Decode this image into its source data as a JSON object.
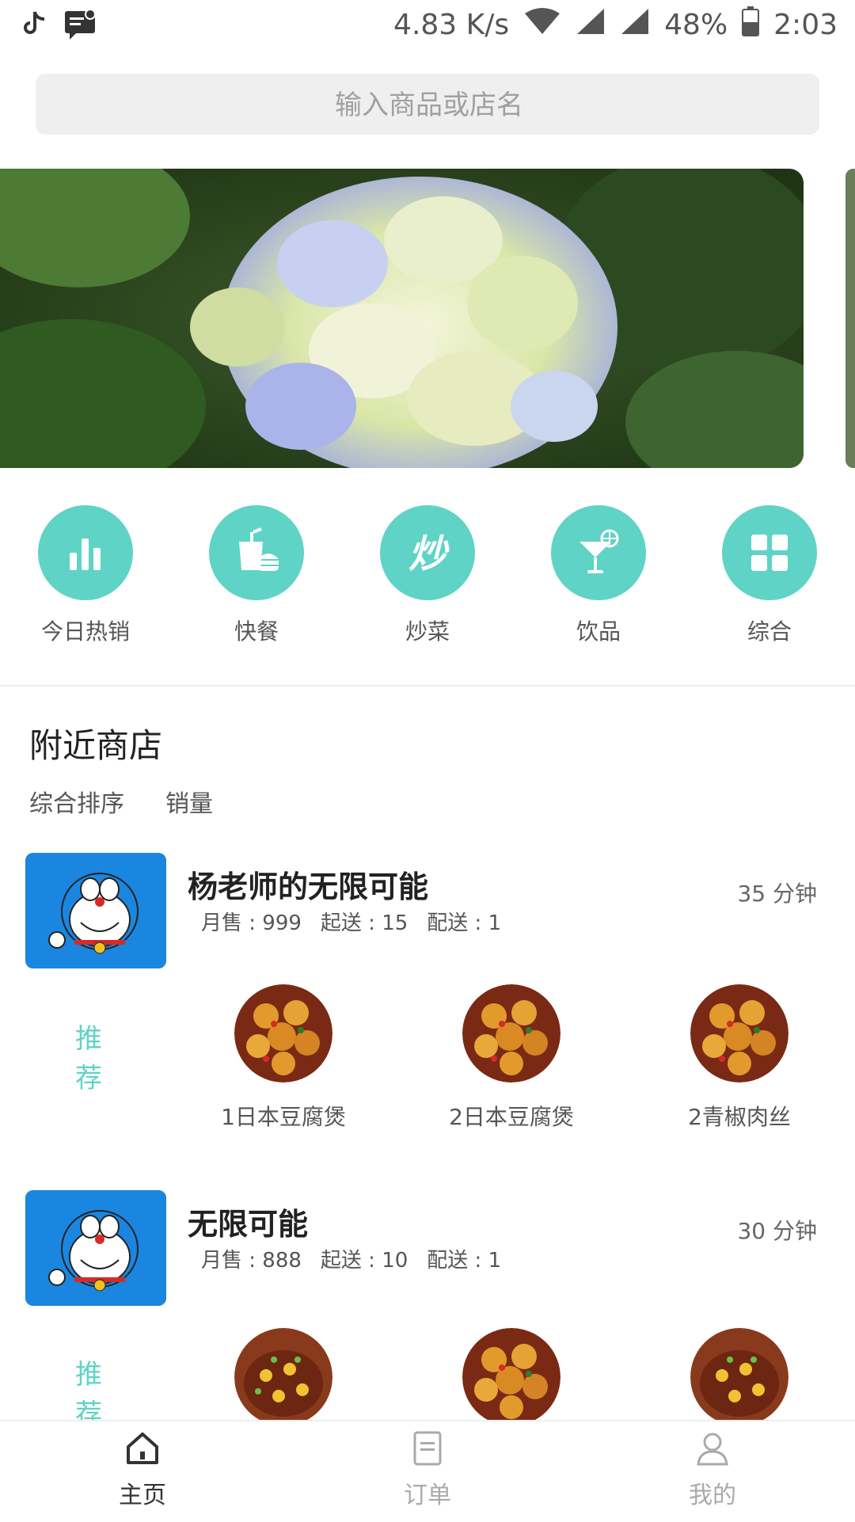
{
  "status_bar": {
    "network_speed": "4.83 K/s",
    "battery": "48%",
    "time": "2:03",
    "icons": [
      "tiktok-icon",
      "notification-icon",
      "wifi-icon",
      "signal-icon",
      "signal-icon",
      "battery-icon"
    ]
  },
  "search": {
    "placeholder": "输入商品或店名"
  },
  "banner": {
    "slide_count": 5,
    "active_index": 2
  },
  "categories": [
    {
      "label": "今日热销",
      "icon": "bar-chart-icon"
    },
    {
      "label": "快餐",
      "icon": "fastfood-icon"
    },
    {
      "label": "炒菜",
      "icon": "stirfry-icon"
    },
    {
      "label": "饮品",
      "icon": "cocktail-icon"
    },
    {
      "label": "综合",
      "icon": "grid-icon"
    }
  ],
  "section": {
    "title": "附近商店",
    "sort_options": [
      "综合排序",
      "销量"
    ]
  },
  "recommend_label": "推荐",
  "shops": [
    {
      "name": "杨老师的无限可能",
      "monthly_sales": "月售 : 999",
      "min_order": "起送 : 15",
      "delivery": "配送 : 1",
      "time": "35 分钟",
      "dishes": [
        "1日本豆腐煲",
        "2日本豆腐煲",
        "2青椒肉丝"
      ]
    },
    {
      "name": "无限可能",
      "monthly_sales": "月售 : 888",
      "min_order": "起送 : 10",
      "delivery": "配送 : 1",
      "time": "30 分钟",
      "dishes": [
        "",
        "",
        ""
      ]
    }
  ],
  "tabbar": [
    {
      "label": "主页",
      "icon": "home-icon",
      "active": true
    },
    {
      "label": "订单",
      "icon": "order-icon",
      "active": false
    },
    {
      "label": "我的",
      "icon": "profile-icon",
      "active": false
    }
  ],
  "colors": {
    "accent": "#5fd3c5",
    "search_bg": "#efefef",
    "shop_logo_bg": "#1a86df"
  }
}
